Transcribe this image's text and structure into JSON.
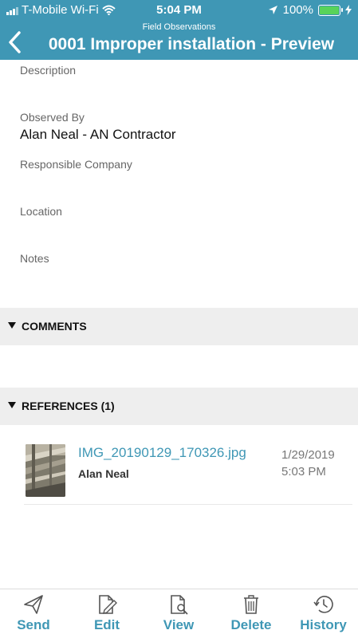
{
  "status_bar": {
    "carrier": "T-Mobile Wi-Fi",
    "time": "5:04 PM",
    "battery": "100%"
  },
  "nav": {
    "subtitle": "Field Observations",
    "title": "0001 Improper installation - Preview"
  },
  "fields": {
    "description_label": "Description",
    "observed_by_label": "Observed By",
    "observed_by_value": "Alan Neal - AN Contractor",
    "responsible_company_label": "Responsible Company",
    "location_label": "Location",
    "notes_label": "Notes"
  },
  "sections": {
    "comments": "COMMENTS",
    "references": "REFERENCES (1)"
  },
  "references": [
    {
      "file_name": "IMG_20190129_170326.jpg",
      "author": "Alan Neal",
      "date": "1/29/2019",
      "time": "5:03 PM"
    }
  ],
  "toolbar": {
    "send": "Send",
    "edit": "Edit",
    "view": "View",
    "delete": "Delete",
    "history": "History"
  },
  "colors": {
    "accent": "#3f97b5",
    "battery": "#58d35a"
  },
  "icons": [
    "signal-icon",
    "wifi-icon",
    "location-arrow-icon",
    "battery-icon",
    "charging-bolt-icon",
    "back-chevron-icon",
    "send-icon",
    "edit-icon",
    "view-icon",
    "delete-icon",
    "history-icon",
    "triangle-down-icon",
    "image-thumbnail"
  ]
}
